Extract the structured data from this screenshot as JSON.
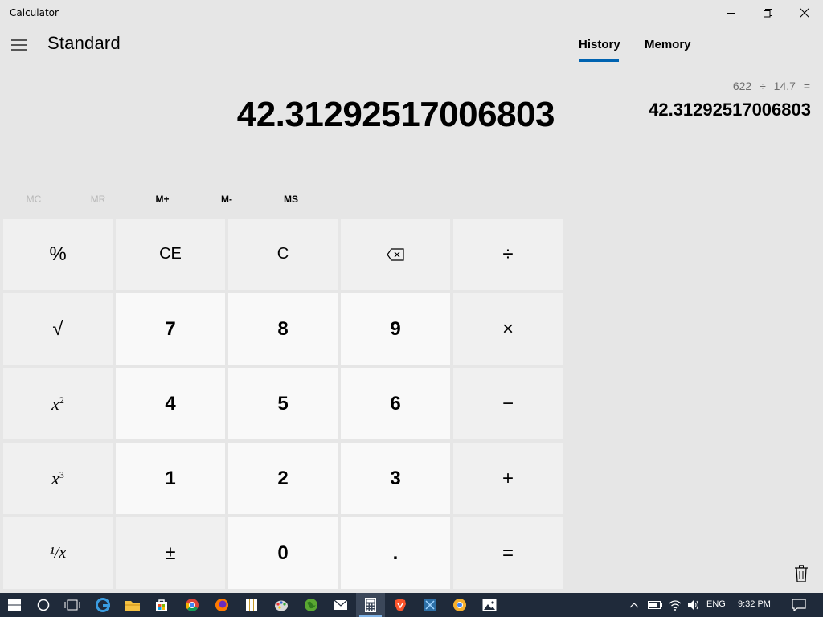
{
  "window": {
    "title": "Calculator"
  },
  "header": {
    "mode": "Standard"
  },
  "display": {
    "value": "42.31292517006803"
  },
  "memory": {
    "mc": "MC",
    "mr": "MR",
    "mplus": "M+",
    "mminus": "M-",
    "ms": "MS"
  },
  "keys": {
    "percent": "%",
    "ce": "CE",
    "c": "C",
    "divide": "÷",
    "sqrt": "√",
    "seven": "7",
    "eight": "8",
    "nine": "9",
    "multiply": "×",
    "square_base": "x",
    "square_exp": "2",
    "four": "4",
    "five": "5",
    "six": "6",
    "minus": "−",
    "cube_base": "x",
    "cube_exp": "3",
    "one": "1",
    "two": "2",
    "three": "3",
    "plus": "+",
    "reciprocal": "¹/x",
    "negate": "±",
    "zero": "0",
    "decimal": ".",
    "equals": "="
  },
  "panel": {
    "tabs": {
      "history": "History",
      "memory": "Memory"
    },
    "history_expression": "622 ÷ 14.7 =",
    "history_result": "42.31292517006803"
  },
  "taskbar": {
    "language": "ENG",
    "time": "9:32 PM"
  },
  "colors": {
    "accent": "#0063b1",
    "background": "#e6e6e6",
    "taskbar": "#1f2a3a"
  }
}
